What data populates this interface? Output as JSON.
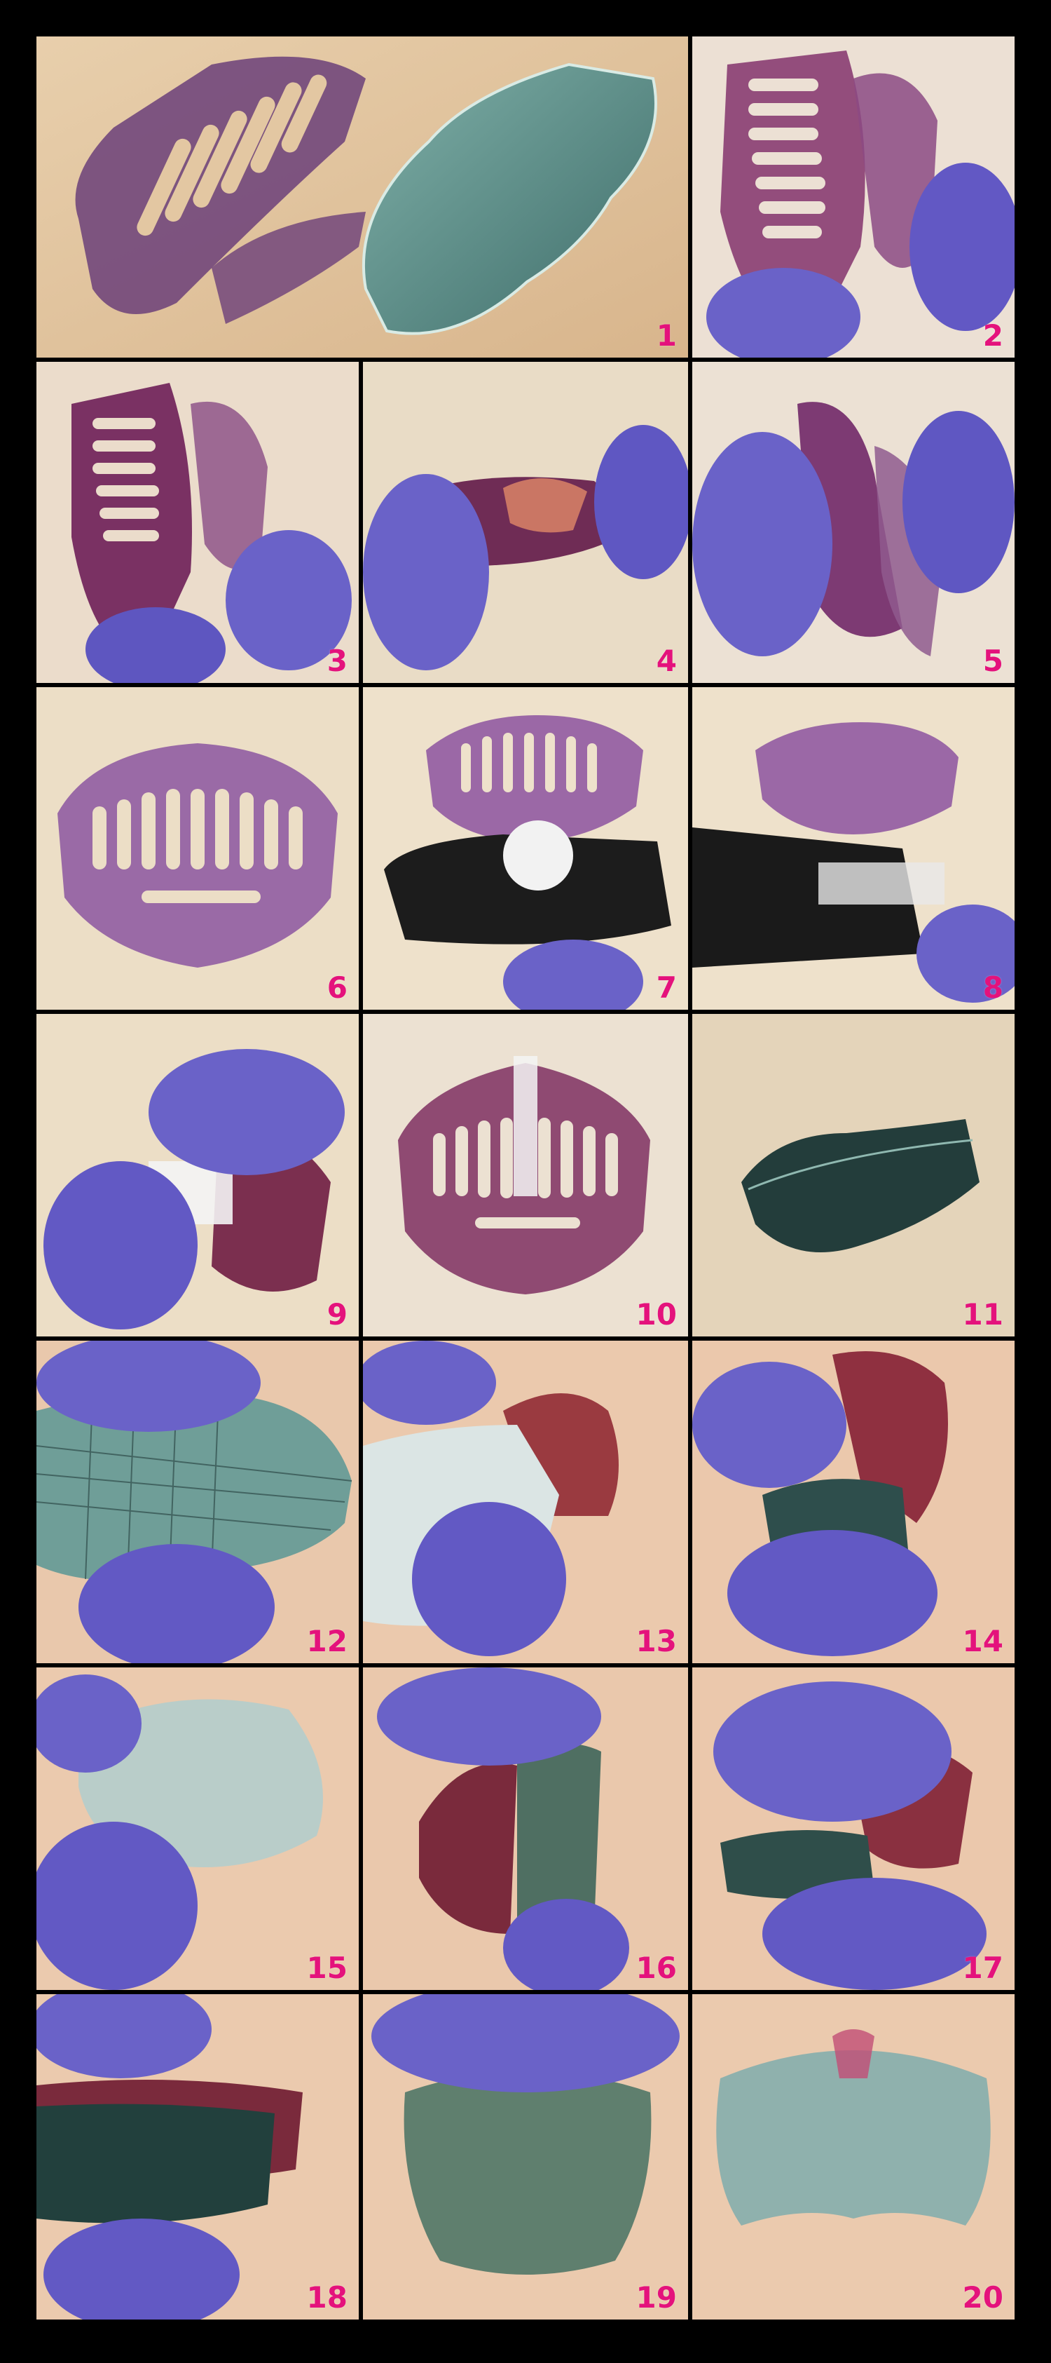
{
  "palette": {
    "frame": "#000000",
    "wood_light": "#e7cfae",
    "wood_pink": "#e9c7ae",
    "wood_pale": "#e9dcc3",
    "mask_purple": "#7a3e7e",
    "mask_maroon": "#7a2a3c",
    "shield_teal": "#5a8b86",
    "glove": "#6a62c8",
    "tape_dispenser": "#1c1c1c",
    "number_color": "#e4127c"
  },
  "panels": [
    {
      "number": "1",
      "content": "mask-frame-and-shield-flat"
    },
    {
      "number": "2",
      "content": "folding-frame"
    },
    {
      "number": "3",
      "content": "folding-frame"
    },
    {
      "number": "4",
      "content": "folding-frame"
    },
    {
      "number": "5",
      "content": "folding-frame"
    },
    {
      "number": "6",
      "content": "formed-frame"
    },
    {
      "number": "7",
      "content": "frame-with-tape-dispenser"
    },
    {
      "number": "8",
      "content": "frame-with-tape-dispenser"
    },
    {
      "number": "9",
      "content": "taping-frame"
    },
    {
      "number": "10",
      "content": "taped-frame"
    },
    {
      "number": "11",
      "content": "shield-flat"
    },
    {
      "number": "12",
      "content": "scoring-shield"
    },
    {
      "number": "13",
      "content": "attaching-shield"
    },
    {
      "number": "14",
      "content": "attaching-shield"
    },
    {
      "number": "15",
      "content": "curving-shield"
    },
    {
      "number": "16",
      "content": "attaching-shield"
    },
    {
      "number": "17",
      "content": "attaching-shield"
    },
    {
      "number": "18",
      "content": "attaching-shield"
    },
    {
      "number": "19",
      "content": "mask-assembled"
    },
    {
      "number": "20",
      "content": "mask-assembled"
    }
  ]
}
